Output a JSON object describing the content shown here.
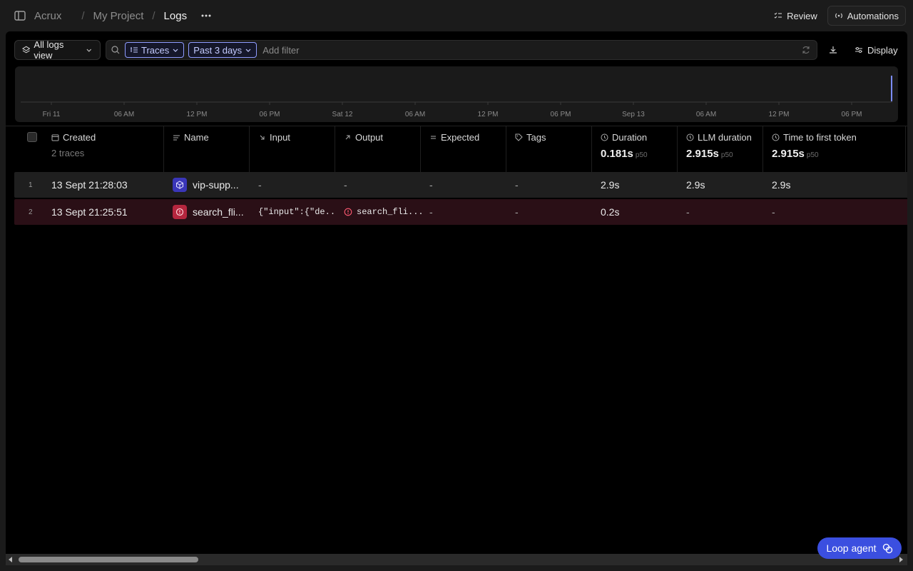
{
  "breadcrumb": {
    "org": "Acrux",
    "project": "My Project",
    "page": "Logs"
  },
  "header": {
    "review_label": "Review",
    "automations_label": "Automations"
  },
  "toolbar": {
    "view_label": "All logs view",
    "traces_chip": "Traces",
    "range_chip": "Past 3 days",
    "filter_placeholder": "Add filter",
    "display_label": "Display"
  },
  "histogram": {
    "ticks": [
      "Fri 11",
      "06 AM",
      "12 PM",
      "06 PM",
      "Sat 12",
      "06 AM",
      "12 PM",
      "06 PM",
      "Sep 13",
      "06 AM",
      "12 PM",
      "06 PM"
    ]
  },
  "columns": {
    "created": {
      "label": "Created",
      "sub": "2 traces"
    },
    "name": {
      "label": "Name"
    },
    "input": {
      "label": "Input"
    },
    "output": {
      "label": "Output"
    },
    "expected": {
      "label": "Expected"
    },
    "tags": {
      "label": "Tags"
    },
    "duration": {
      "label": "Duration",
      "stat": "0.181s",
      "stat_suffix": "p50"
    },
    "llm_duration": {
      "label": "LLM duration",
      "stat": "2.915s",
      "stat_suffix": "p50"
    },
    "ttft": {
      "label": "Time to first token",
      "stat": "2.915s",
      "stat_suffix": "p50"
    }
  },
  "rows": [
    {
      "num": "1",
      "created": "13 Sept 21:28:03",
      "name": "vip-supp...",
      "input": "-",
      "output": "-",
      "expected": "-",
      "tags": "-",
      "duration": "2.9s",
      "llm_duration": "2.9s",
      "ttft": "2.9s",
      "status": "ok"
    },
    {
      "num": "2",
      "created": "13 Sept 21:25:51",
      "name": "search_fli...",
      "input": "{\"input\":{\"de...",
      "output": "search_fli...",
      "expected": "-",
      "tags": "-",
      "duration": "0.2s",
      "llm_duration": "-",
      "ttft": "-",
      "status": "error"
    }
  ],
  "loop_agent_label": "Loop agent",
  "colors": {
    "accent": "#3b4fe0",
    "error_row": "#2a0f16",
    "chip_border": "#8f9cff",
    "bar": "#7b8cff"
  }
}
